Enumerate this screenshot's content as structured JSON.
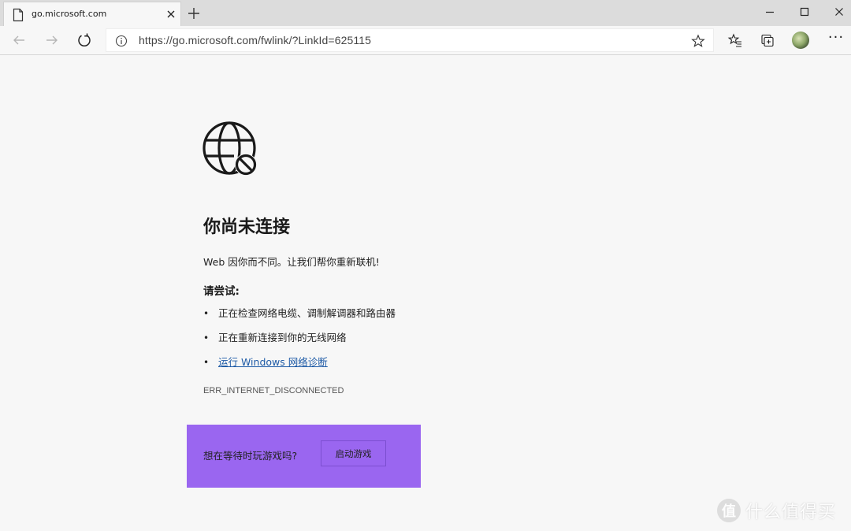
{
  "tab": {
    "title": "go.microsoft.com",
    "icon": "page-icon",
    "close_icon": "close-icon"
  },
  "new_tab_icon": "plus-icon",
  "window_controls": [
    "minimize-icon",
    "maximize-icon",
    "close-icon"
  ],
  "toolbar": {
    "back_icon": "back-arrow-icon",
    "forward_icon": "forward-arrow-icon",
    "refresh_icon": "refresh-icon",
    "url": "https://go.microsoft.com/fwlink/?LinkId=625115",
    "info_icon": "info-icon",
    "favorite_icon": "star-icon",
    "favorites_list_icon": "favorites-list-icon",
    "collections_icon": "collections-icon",
    "profile_icon": "avatar",
    "more_label": "···"
  },
  "page": {
    "icon": "globe-no-connection-icon",
    "heading": "你尚未连接",
    "subtitle": "Web 因你而不同。让我们帮你重新联机!",
    "try_label": "请尝试:",
    "tips": [
      "正在检查网络电缆、调制解调器和路由器",
      "正在重新连接到你的无线网络"
    ],
    "diagnose_link": "运行 Windows 网络诊断",
    "error_code": "ERR_INTERNET_DISCONNECTED",
    "game_prompt": "想在等待时玩游戏吗?",
    "game_button": "启动游戏"
  },
  "colors": {
    "game_box": "#9a66f0",
    "link": "#1d5aa6",
    "tab_strip": "#dcdcdc",
    "page_background": "#f7f7f7"
  },
  "watermark": {
    "logo_char": "值",
    "text": "什么值得买"
  }
}
